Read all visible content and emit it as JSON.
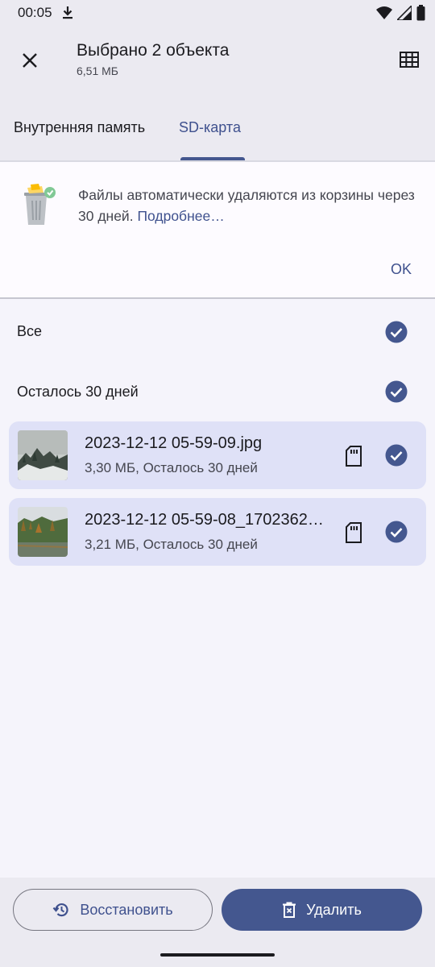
{
  "status": {
    "time": "00:05"
  },
  "header": {
    "title": "Выбрано 2 объекта",
    "subtitle": "6,51 МБ"
  },
  "tabs": [
    {
      "label": "Внутренняя память",
      "selected": false
    },
    {
      "label": "SD-карта",
      "selected": true
    }
  ],
  "info": {
    "text": "Файлы автоматически удаляются из корзины через 30 дней.",
    "link": "Подробнее…",
    "ok_label": "OK"
  },
  "rows": {
    "all_label": "Все",
    "group_label": "Осталось 30 дней"
  },
  "files": [
    {
      "name": "2023-12-12 05-59-09.jpg",
      "meta": "3,30 МБ, Осталось 30 дней",
      "location_icon": "sd-card-icon",
      "checked": true
    },
    {
      "name": "2023-12-12 05-59-08_1702362…",
      "meta": "3,21 МБ, Осталось 30 дней",
      "location_icon": "sd-card-icon",
      "checked": true
    }
  ],
  "actions": {
    "restore_label": "Восстановить",
    "delete_label": "Удалить"
  },
  "colors": {
    "accent": "#44578f",
    "selected_card": "#dfe1f7",
    "header_bg": "#ebeaf1"
  }
}
